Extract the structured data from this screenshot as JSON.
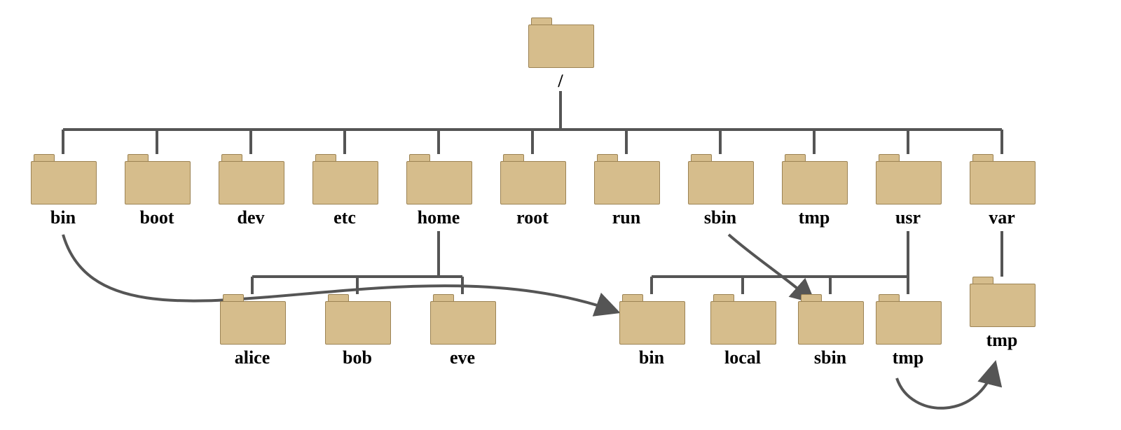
{
  "colors": {
    "folder_fill": "#d6bd8c",
    "folder_stroke": "#9c8354",
    "line": "#555555"
  },
  "diagram": {
    "root": {
      "label": "/"
    },
    "level1": [
      {
        "id": "bin",
        "label": "bin"
      },
      {
        "id": "boot",
        "label": "boot"
      },
      {
        "id": "dev",
        "label": "dev"
      },
      {
        "id": "etc",
        "label": "etc"
      },
      {
        "id": "home",
        "label": "home"
      },
      {
        "id": "root",
        "label": "root"
      },
      {
        "id": "run",
        "label": "run"
      },
      {
        "id": "sbin",
        "label": "sbin"
      },
      {
        "id": "tmp",
        "label": "tmp"
      },
      {
        "id": "usr",
        "label": "usr"
      },
      {
        "id": "var",
        "label": "var"
      }
    ],
    "home_children": [
      {
        "id": "alice",
        "label": "alice"
      },
      {
        "id": "bob",
        "label": "bob"
      },
      {
        "id": "eve",
        "label": "eve"
      }
    ],
    "usr_children": [
      {
        "id": "usr_bin",
        "label": "bin"
      },
      {
        "id": "usr_local",
        "label": "local"
      },
      {
        "id": "usr_sbin",
        "label": "sbin"
      },
      {
        "id": "usr_tmp",
        "label": "tmp"
      }
    ],
    "var_children": [
      {
        "id": "var_tmp",
        "label": "tmp"
      }
    ],
    "symlinks": [
      {
        "from": "bin",
        "to": "usr_bin"
      },
      {
        "from": "sbin",
        "to": "usr_sbin"
      },
      {
        "from": "usr_tmp",
        "to": "var_tmp"
      }
    ]
  }
}
